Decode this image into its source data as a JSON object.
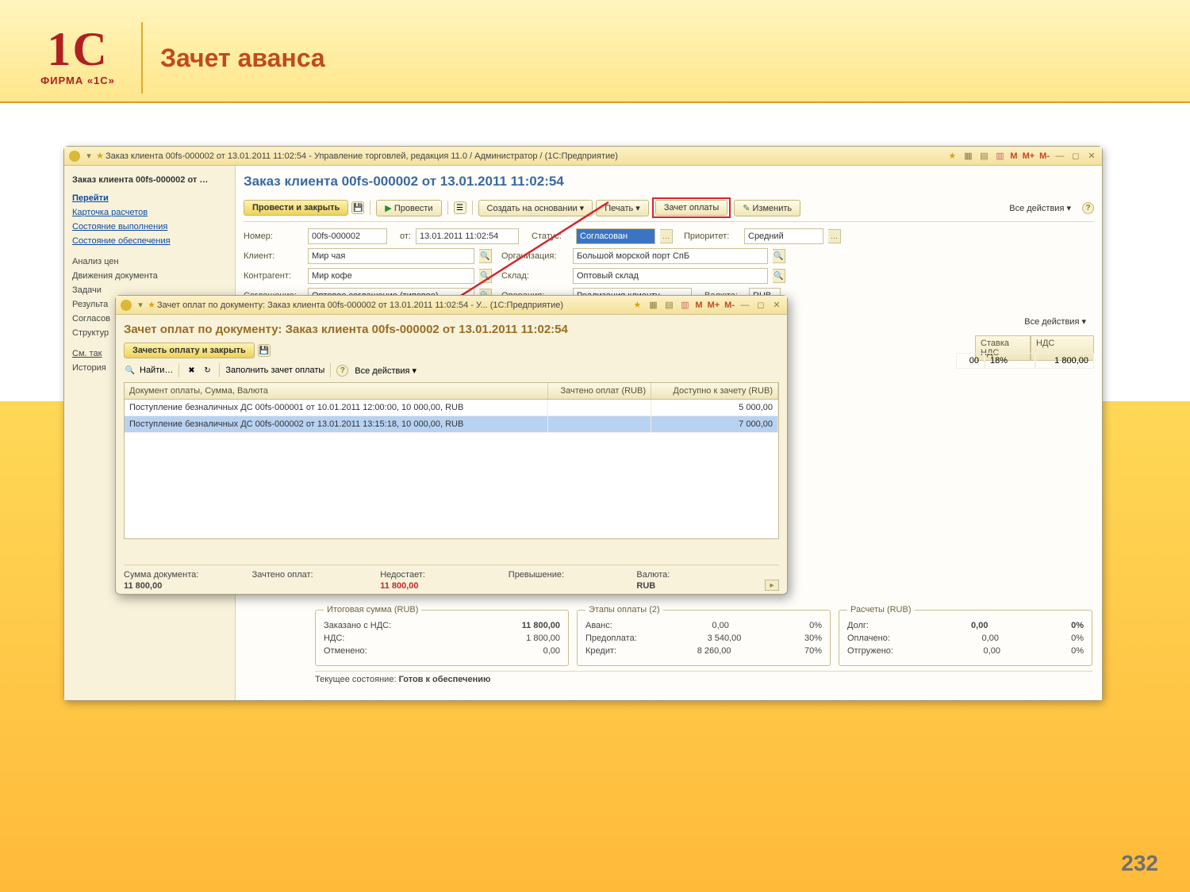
{
  "slide": {
    "logo_text": "1C",
    "logo_sub": "ФИРМА «1С»",
    "title": "Зачет аванса",
    "page_num": "232"
  },
  "main": {
    "titlebar": "Заказ клиента 00fs-000002 от 13.01.2011 11:02:54 - Управление торговлей, редакция 11.0 / Администратор /  (1С:Предприятие)",
    "m_labels": [
      "M",
      "M+",
      "M-"
    ],
    "nav": {
      "title": "Заказ клиента 00fs-000002 от …",
      "section1": "Перейти",
      "links1": [
        "Карточка расчетов",
        "Состояние выполнения",
        "Состояние обеспечения"
      ],
      "links2": [
        "Анализ цен",
        "Движения документа",
        "Задачи",
        "Результа",
        "Согласов",
        "Структур"
      ],
      "links3_label": "См. так",
      "links3": [
        "История"
      ]
    },
    "form": {
      "title": "Заказ клиента 00fs-000002 от 13.01.2011 11:02:54",
      "tb": {
        "post_close": "Провести и закрыть",
        "post": "Провести",
        "create_base": "Создать на основании ▾",
        "print": "Печать ▾",
        "offset": "Зачет оплаты",
        "edit": "Изменить",
        "all": "Все действия ▾"
      },
      "rows": {
        "number_l": "Номер:",
        "number": "00fs-000002",
        "from_l": "от:",
        "from": "13.01.2011 11:02:54",
        "status_l": "Статус:",
        "status": "Согласован",
        "priority_l": "Приоритет:",
        "priority": "Средний",
        "client_l": "Клиент:",
        "client": "Мир чая",
        "org_l": "Организация:",
        "org": "Большой морской порт СпБ",
        "contr_l": "Контрагент:",
        "contr": "Мир кофе",
        "store_l": "Склад:",
        "store": "Оптовый склад",
        "agr_l": "Соглашение:",
        "agr": "Оптовое соглашение (типовое)",
        "op_l": "Операция:",
        "op": "Реализация клиенту",
        "curr_l": "Валюта:",
        "curr": "RUB"
      },
      "grid_cols": {
        "rate": "Ставка НДС",
        "nds": "НДС"
      },
      "grid_row": {
        "total": "00",
        "rate": "18%",
        "nds": "1 800,00"
      },
      "all_actions2": "Все действия ▾"
    },
    "footer": {
      "g1_legend": "Итоговая сумма (RUB)",
      "g1": [
        {
          "l": "Заказано с НДС:",
          "v": "11 800,00",
          "bold": true
        },
        {
          "l": "НДС:",
          "v": "1 800,00"
        },
        {
          "l": "Отменено:",
          "v": "0,00"
        }
      ],
      "g2_legend": "Этапы оплаты (2)",
      "g2": [
        {
          "l": "Аванс:",
          "v": "0,00",
          "p": "0%"
        },
        {
          "l": "Предоплата:",
          "v": "3 540,00",
          "p": "30%"
        },
        {
          "l": "Кредит:",
          "v": "8 260,00",
          "p": "70%"
        }
      ],
      "g3_legend": "Расчеты (RUB)",
      "g3": [
        {
          "l": "Долг:",
          "v": "0,00",
          "p": "0%",
          "bold": true
        },
        {
          "l": "Оплачено:",
          "v": "0,00",
          "p": "0%"
        },
        {
          "l": "Отгружено:",
          "v": "0,00",
          "p": "0%"
        }
      ],
      "status_l": "Текущее состояние:",
      "status_v": "Готов к обеспечению"
    }
  },
  "dialog": {
    "titlebar": "Зачет оплат по документу: Заказ клиента 00fs-000002 от 13.01.2011 11:02:54 - У...  (1С:Предприятие)",
    "m_labels": [
      "M",
      "M+",
      "M-"
    ],
    "title": "Зачет оплат по документу: Заказ клиента 00fs-000002 от 13.01.2011 11:02:54",
    "tb": {
      "apply": "Зачесть оплату и закрыть"
    },
    "sub": {
      "find": "Найти…",
      "fill": "Заполнить зачет оплаты",
      "all": "Все действия ▾"
    },
    "cols": {
      "doc": "Документ оплаты, Сумма, Валюта",
      "applied": "Зачтено оплат (RUB)",
      "avail": "Доступно к зачету (RUB)"
    },
    "rows": [
      {
        "doc": "Поступление безналичных ДС 00fs-000001 от 10.01.2011 12:00:00, 10 000,00, RUB",
        "applied": "",
        "avail": "5 000,00"
      },
      {
        "doc": "Поступление безналичных ДС 00fs-000002 от 13.01.2011 13:15:18, 10 000,00, RUB",
        "applied": "",
        "avail": "7 000,00"
      }
    ],
    "foot": {
      "sum_l": "Сумма документа:",
      "sum": "11 800,00",
      "applied_l": "Зачтено оплат:",
      "applied": "",
      "short_l": "Недостает:",
      "short": "11 800,00",
      "over_l": "Превышение:",
      "over": "",
      "curr_l": "Валюта:",
      "curr": "RUB"
    }
  }
}
